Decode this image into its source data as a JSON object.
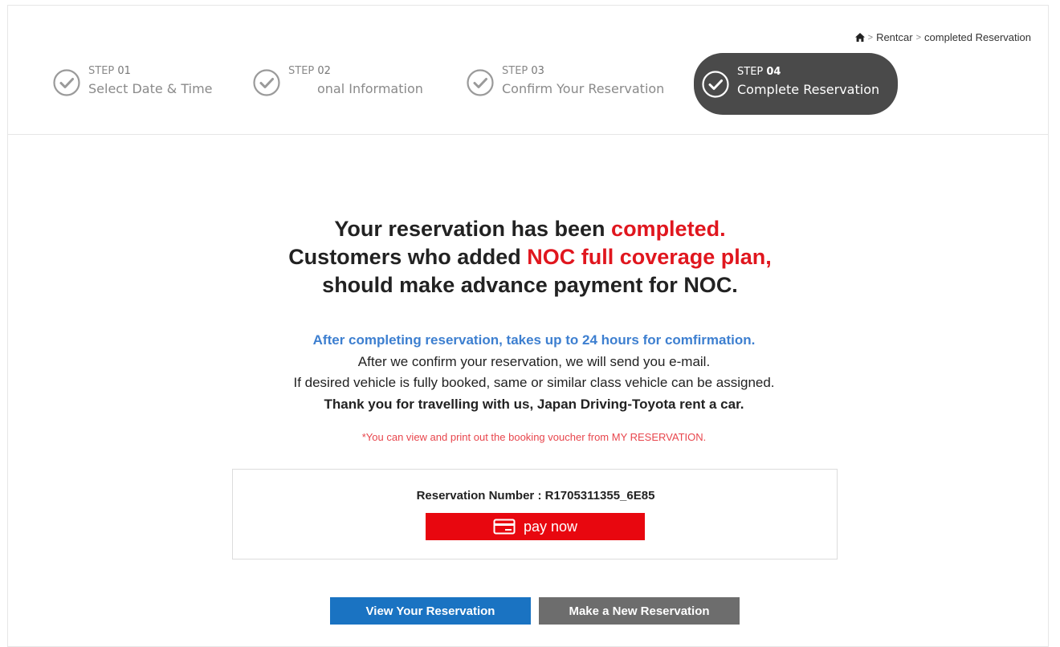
{
  "breadcrumb": {
    "home_icon": "home-icon",
    "separator": ">",
    "items": [
      "Rentcar",
      "completed Reservation"
    ]
  },
  "steps": [
    {
      "prefix": "STEP",
      "number": "01",
      "label": "Select Date & Time",
      "active": false
    },
    {
      "prefix": "STEP",
      "number": "02",
      "label": "onal Information",
      "active": false
    },
    {
      "prefix": "STEP",
      "number": "03",
      "label": "Confirm Your Reservation",
      "active": false
    },
    {
      "prefix": "STEP",
      "number": "04",
      "label": "Complete Reservation",
      "active": true
    }
  ],
  "heading": {
    "line1_prefix": "Your reservation has been ",
    "line1_highlight": "completed.",
    "line2_prefix": "Customers who added ",
    "line2_highlight": "NOC full coverage plan,",
    "line3": "should make advance payment for NOC."
  },
  "info": {
    "confirm_notice": "After completing reservation, takes up to 24 hours for comfirmation.",
    "email_notice": "After we confirm your reservation, we will send you e-mail.",
    "vehicle_notice": "If desired vehicle is fully booked, same or similar class vehicle can be assigned.",
    "thanks": "Thank you for travelling with us, Japan Driving-Toyota rent a car.",
    "voucher_note": "*You can view and print out the booking voucher from MY RESERVATION."
  },
  "reservation": {
    "label": "Reservation Number : ",
    "number": "R1705311355_6E85",
    "pay_label": "pay now",
    "pay_icon": "credit-card-icon"
  },
  "actions": {
    "view_label": "View Your Reservation",
    "new_label": "Make a New Reservation"
  },
  "colors": {
    "accent_red": "#e0161e",
    "info_blue": "#3d7fd0",
    "pay_button": "#e8070f",
    "view_button": "#1a73c2",
    "new_button": "#6d6d6d",
    "active_step": "#4a4a4a"
  }
}
